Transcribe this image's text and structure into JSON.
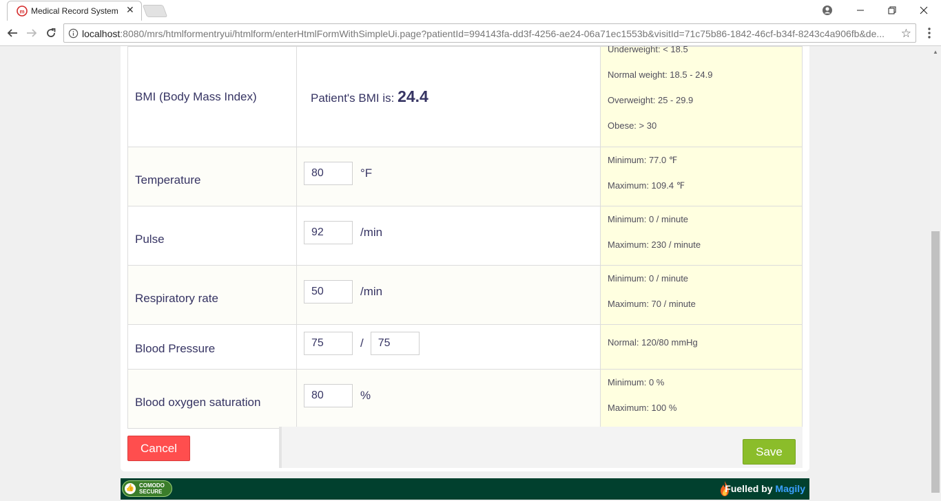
{
  "browser": {
    "tab_title": "Medical Record System",
    "url_host": "localhost",
    "url_rest": ":8080/mrs/htmlformentryui/htmlform/enterHtmlFormWithSimpleUi.page?patientId=994143fa-dd3f-4256-ae24-06a71ec1553b&visitId=71c75b86-1842-46cf-b34f-8243c4a906fb&de..."
  },
  "bmi": {
    "label": "BMI (Body Mass Index)",
    "prefix": "Patient's BMI is: ",
    "value": "24.4",
    "hints": [
      "Underweight: < 18.5",
      "Normal weight: 18.5 - 24.9",
      "Overweight: 25 - 29.9",
      "Obese: > 30"
    ]
  },
  "temperature": {
    "label": "Temperature",
    "value": "80",
    "unit": "°F",
    "hints": [
      "Minimum: 77.0 ℉",
      "Maximum: 109.4 ℉"
    ]
  },
  "pulse": {
    "label": "Pulse",
    "value": "92",
    "unit": "/min",
    "hints": [
      "Minimum: 0 / minute",
      "Maximum: 230 / minute"
    ]
  },
  "respiratory": {
    "label": "Respiratory rate",
    "value": "50",
    "unit": "/min",
    "hints": [
      "Minimum: 0 / minute",
      "Maximum: 70 / minute"
    ]
  },
  "blood_pressure": {
    "label": "Blood Pressure",
    "systolic": "75",
    "separator": "/",
    "diastolic": "75",
    "hints": [
      "Normal: 120/80 mmHg"
    ]
  },
  "oxygen": {
    "label": "Blood oxygen saturation",
    "value": "80",
    "unit": "%",
    "hints": [
      "Minimum: 0 %",
      "Maximum: 100 %"
    ]
  },
  "actions": {
    "cancel": "Cancel",
    "save": "Save"
  },
  "footer": {
    "comodo_line1": "COMODO",
    "comodo_line2": "SECURE",
    "fuelled_prefix": "Fuelled by ",
    "fuelled_brand": "Magily"
  },
  "colors": {
    "cancel": "#ff4e4e",
    "save": "#8bbd2a",
    "hint_bg": "#ffffe0",
    "footer_bg": "#01402e",
    "text": "#363463"
  }
}
